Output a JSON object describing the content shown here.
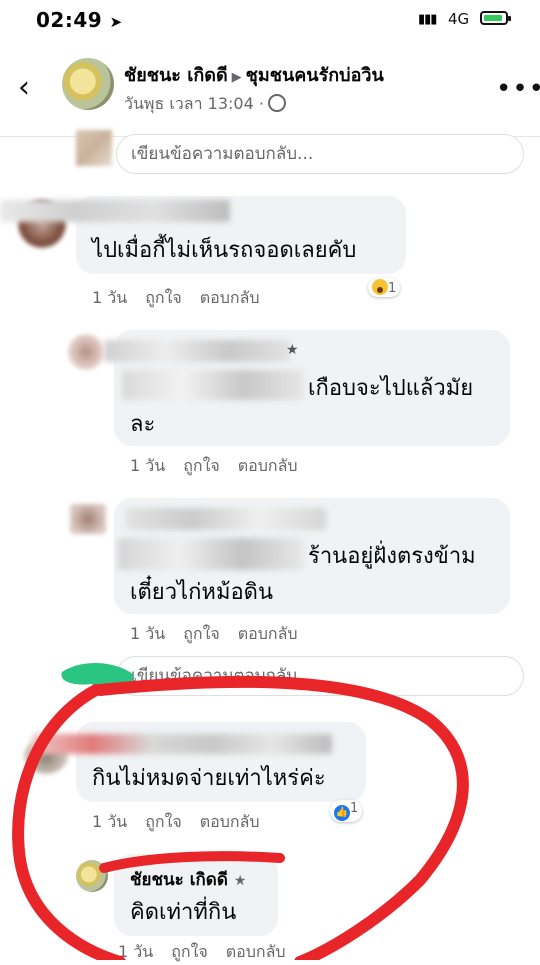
{
  "status": {
    "time": "02:49",
    "network": "4G"
  },
  "header": {
    "author": "ชัยชนะ เกิดดี",
    "group": "ชุมชนคนรักบ่อวิน",
    "time": "วันพุธ เวลา 13:04 ·"
  },
  "reply_placeholder": "เขียนข้อความตอบกลับ...",
  "comments": [
    {
      "text": "ไปเมื่อกี้ไม่เห็นรถจอดเลยคับ",
      "age": "1 วัน",
      "like": "ถูกใจ",
      "reply": "ตอบกลับ",
      "reaction_count": "1"
    },
    {
      "text_visible": "เกือบจะไปแล้วมัย",
      "text_line2": "ละ",
      "age": "1 วัน",
      "like": "ถูกใจ",
      "reply": "ตอบกลับ"
    },
    {
      "text_visible": "ร้านอยู่ฝั่งตรงข้าม",
      "text_line2": "เตี๋ยวไก่หม้อดิน",
      "age": "1 วัน",
      "like": "ถูกใจ",
      "reply": "ตอบกลับ"
    },
    {
      "text": "กินไม่หมดจ่ายเท่าไหร่ค่ะ",
      "age": "1 วัน",
      "like": "ถูกใจ",
      "reply": "ตอบกลับ",
      "reaction_count": "1"
    },
    {
      "author": "ชัยชนะ เกิดดี",
      "text": "คิดเท่าที่กิน",
      "age": "1 วัน",
      "like": "ถูกใจ",
      "reply": "ตอบกลับ"
    }
  ],
  "colors": {
    "annotation_red": "#e8262a",
    "annotation_green": "#1fc37a",
    "accent": "#1877f2"
  }
}
